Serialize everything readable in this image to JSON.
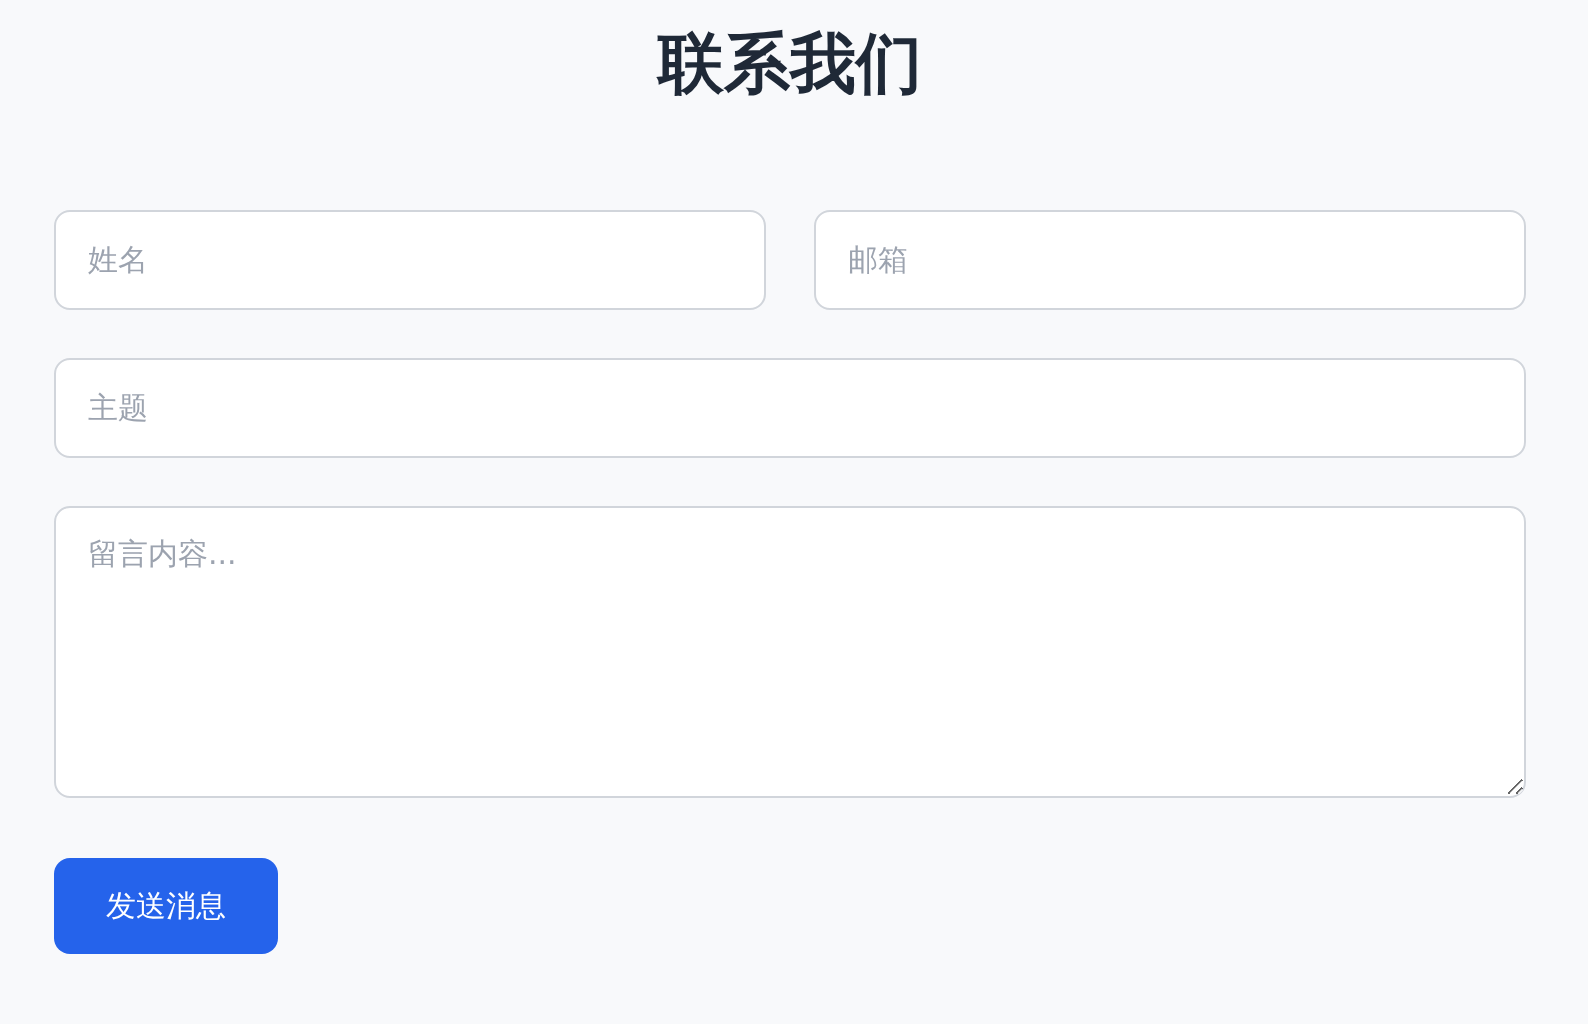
{
  "title": "联系我们",
  "rows": [
    {
      "fields": [
        {
          "kind": "input",
          "placeholder": "姓名"
        },
        {
          "kind": "input",
          "placeholder": "邮箱"
        }
      ]
    },
    {
      "fields": [
        {
          "kind": "input",
          "placeholder": "主题"
        }
      ]
    },
    {
      "fields": [
        {
          "kind": "textarea",
          "placeholder": "留言内容..."
        }
      ]
    }
  ],
  "submit_button": {
    "label": "发送消息"
  }
}
